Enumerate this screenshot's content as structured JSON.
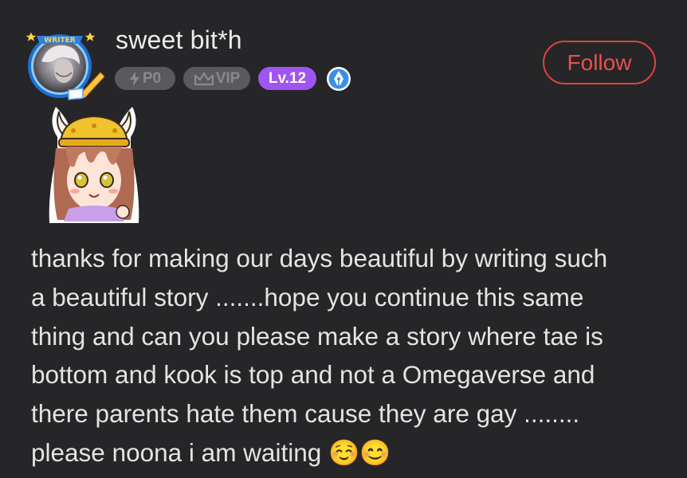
{
  "user": {
    "name": "sweet bit*h",
    "avatar_frame_label": "WRITER"
  },
  "badges": {
    "po": "P0",
    "vip": "VIP",
    "level": "Lv.12",
    "writer_icon": "pen-nib-icon"
  },
  "actions": {
    "follow_label": "Follow"
  },
  "comment": {
    "sticker": "viking-girl-sticker",
    "text": "thanks for making our days beautiful by writing such\na beautiful story .......hope you continue this same\nthing and can you please make a story where tae is\nbottom and kook is top and not a Omegaverse and\nthere parents hate them cause they are gay ........\nplease noona i am waiting ☺️😊"
  },
  "colors": {
    "background": "#262528",
    "follow_accent": "#e0443c",
    "level_badge": "#a055f2",
    "muted_badge": "#5a5a5c",
    "writer_badge": "#3a8fe8"
  }
}
